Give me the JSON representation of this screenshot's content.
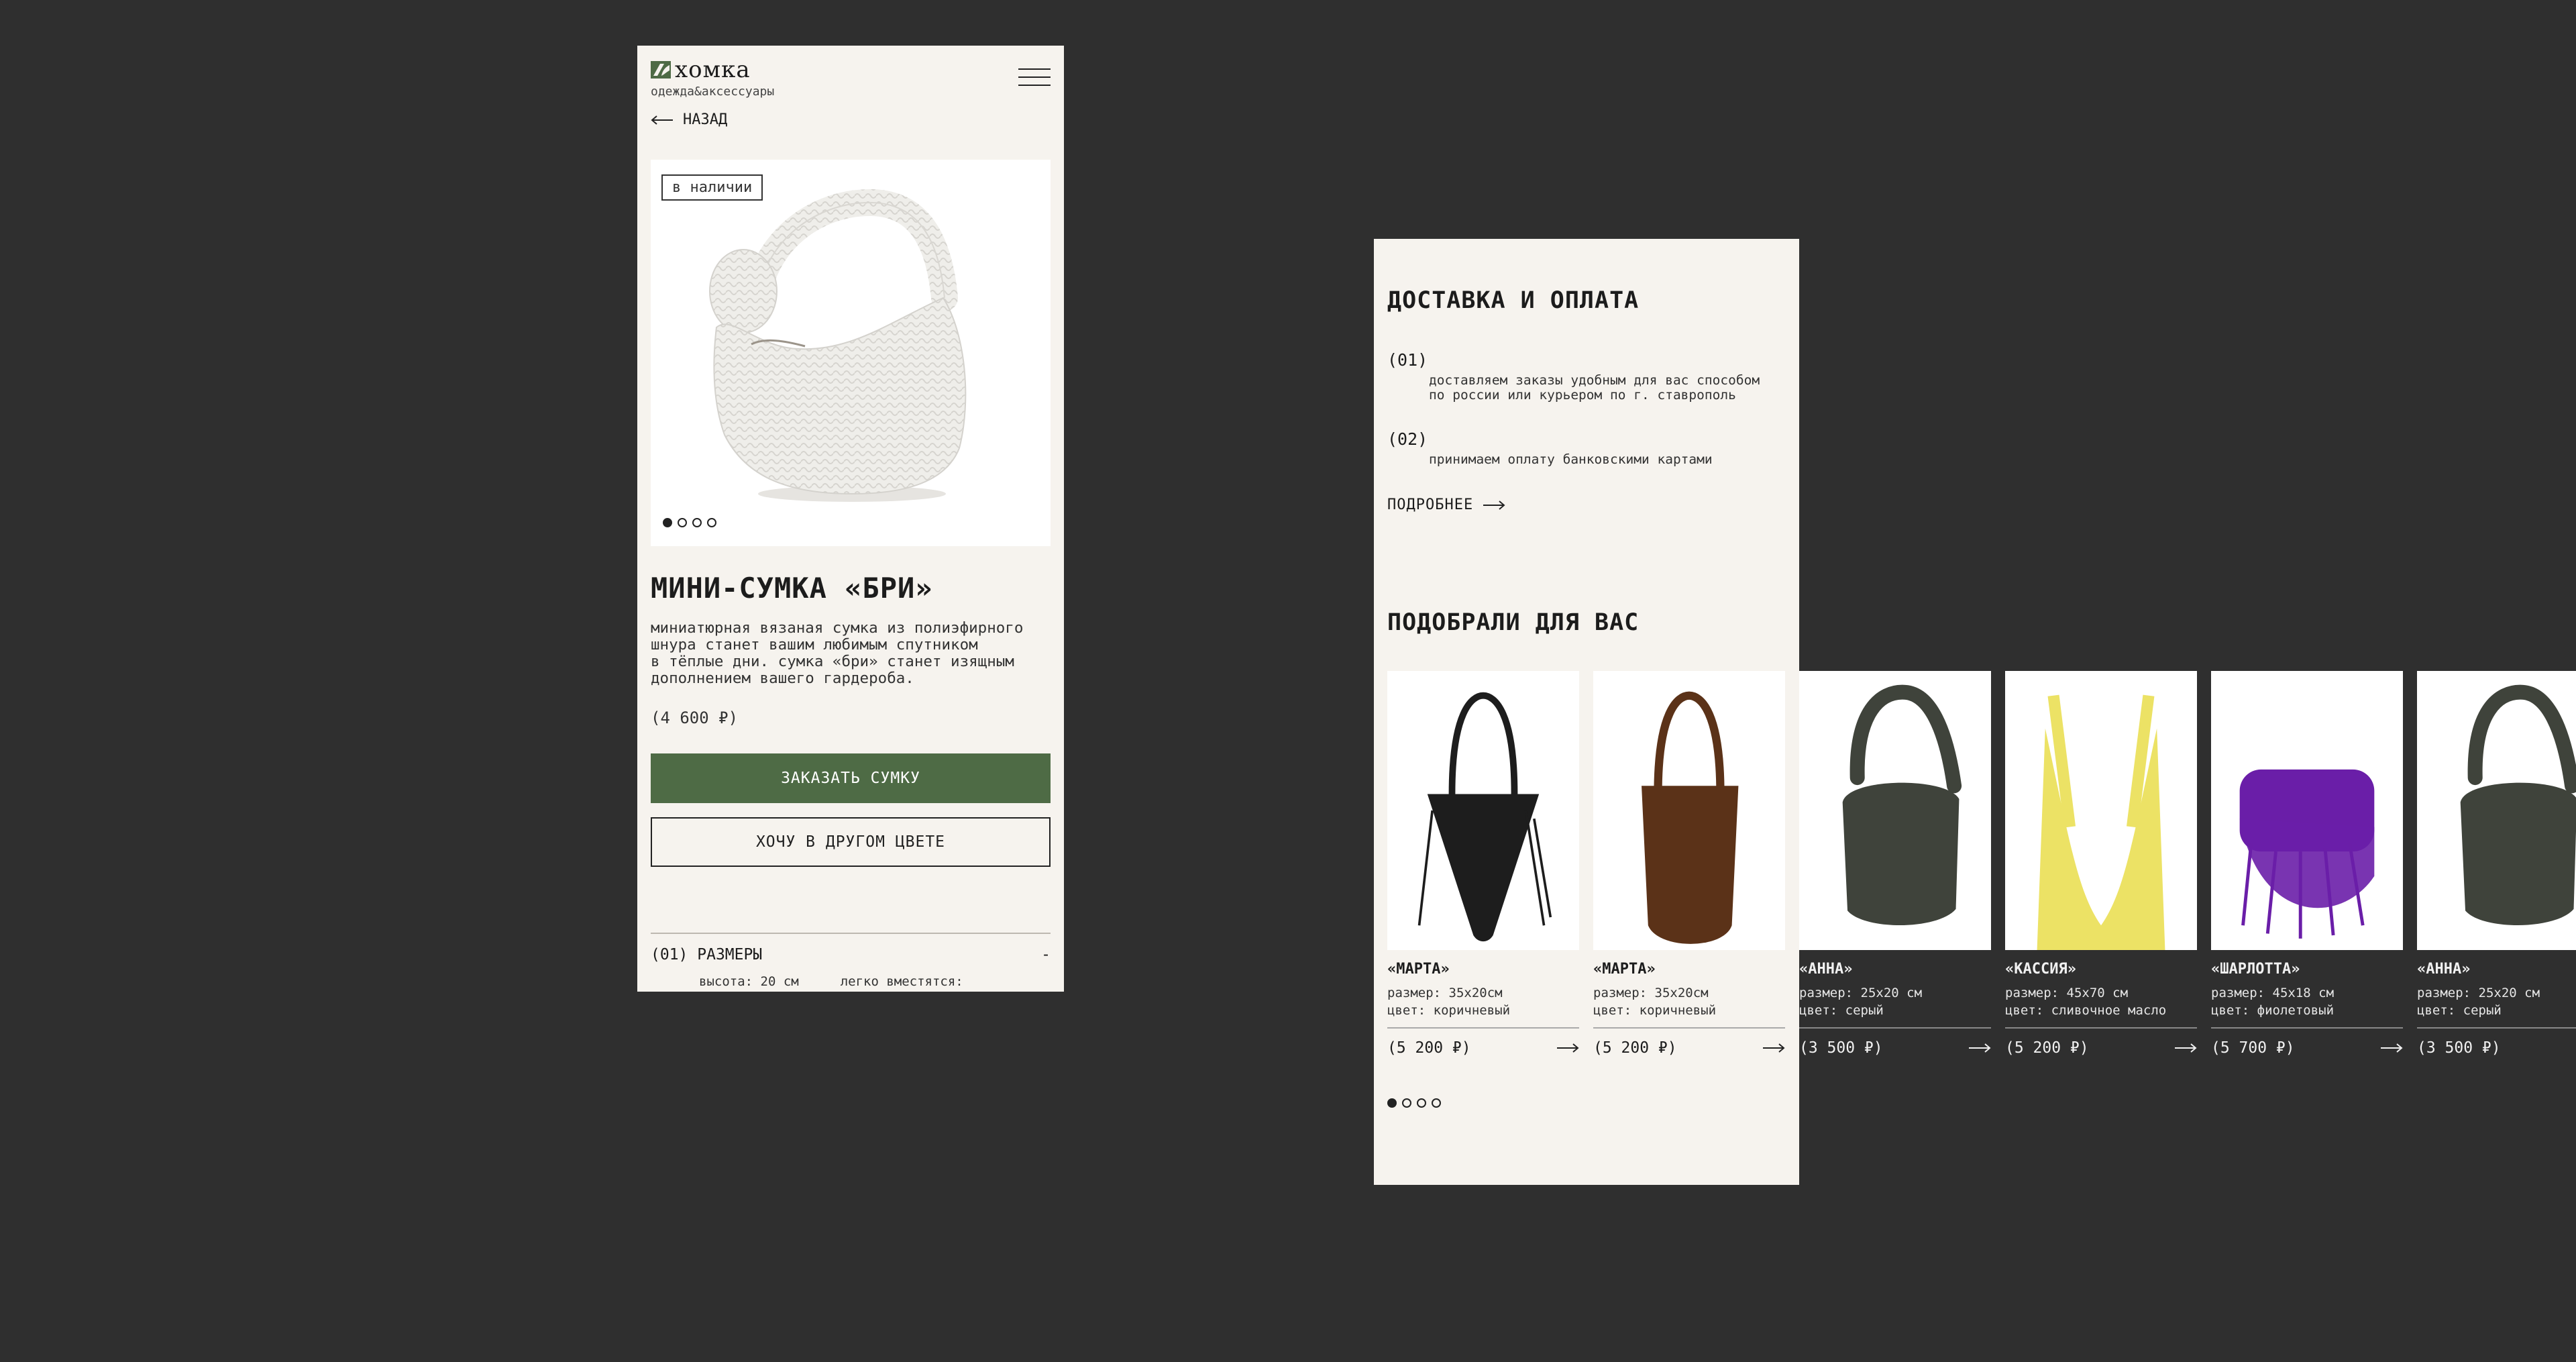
{
  "header": {
    "logo_text": "хомка",
    "tagline": "одежда&аксессуары"
  },
  "nav": {
    "back_label": "НАЗАД"
  },
  "product": {
    "stock_badge": "в наличии",
    "title": "МИНИ-СУМКА «БРИ»",
    "description": "миниатюрная вязаная сумка из полиэфирного\nшнура станет вашим любимым спутником\nв тёплые дни. сумка «бри» станет изящным\nдополнением вашего гардероба.",
    "price": "(4 600 ₽)",
    "gallery_images_count": 4,
    "gallery_active_index": 0,
    "order_button": "ЗАКАЗАТЬ СУМКУ",
    "other_color_button": "ХОЧУ В ДРУГОМ ЦВЕТЕ"
  },
  "sizes": {
    "number": "(01)",
    "label": "РАЗМЕРЫ",
    "toggle": "-",
    "height": "высота: 20 см",
    "fits": "легко вместятся:"
  },
  "delivery": {
    "title": "ДОСТАВКА И ОПЛАТА",
    "items": [
      {
        "num": "(01)",
        "text": "доставляем заказы удобным для вас способом\nпо россии или курьером по г. ставрополь"
      },
      {
        "num": "(02)",
        "text": "принимаем оплату банковскими картами"
      }
    ],
    "more_label": "ПОДРОБНЕЕ"
  },
  "recommendations": {
    "title": "ПОДОБРАЛИ ДЛЯ ВАС",
    "dots_count": 4,
    "active_dot": 0,
    "items": [
      {
        "name": "«МАРТА»",
        "size": "размер: 35х20см",
        "color": "цвет: коричневый",
        "price": "(5 200 ₽)",
        "bag": "black",
        "bag_color": "#1d1d1d"
      },
      {
        "name": "«МАРТА»",
        "size": "размер: 35х20см",
        "color": "цвет: коричневый",
        "price": "(5 200 ₽)",
        "bag": "brown",
        "bag_color": "#5b3218"
      },
      {
        "name": "«АННА»",
        "size": "размер: 25х20 см",
        "color": "цвет: серый",
        "price": "(3 500 ₽)",
        "bag": "gray",
        "bag_color": "#3f433b"
      },
      {
        "name": "«КАССИЯ»",
        "size": "размер: 45х70 см",
        "color": "цвет: сливочное масло",
        "price": "(5 200 ₽)",
        "bag": "yellow",
        "bag_color": "#ece265"
      },
      {
        "name": "«ШАРЛОТТА»",
        "size": "размер: 45х18 см",
        "color": "цвет: фиолетовый",
        "price": "(5 700 ₽)",
        "bag": "purple",
        "bag_color": "#6a1ea8"
      },
      {
        "name": "«АННА»",
        "size": "размер: 25х20 см",
        "color": "цвет: серый",
        "price": "(3 500 ₽)",
        "bag": "gray",
        "bag_color": "#3f433b"
      }
    ]
  },
  "colors": {
    "accent_green": "#4e6b45",
    "page_bg": "#f6f3ee",
    "canvas_bg": "#2f2f2f"
  }
}
